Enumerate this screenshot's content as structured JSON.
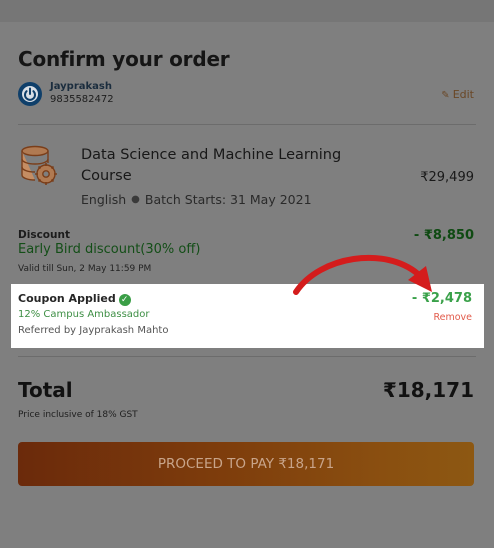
{
  "page": {
    "title": "Confirm your order"
  },
  "user": {
    "name": "Jayprakash",
    "phone": "9835582472",
    "edit_label": "Edit"
  },
  "course": {
    "name": "Data Science and Machine Learning Course",
    "language": "English",
    "batch": "Batch Starts: 31 May 2021",
    "price": "₹29,499"
  },
  "discount": {
    "label": "Discount",
    "name": "Early Bird discount(30% off)",
    "validity": "Valid till Sun, 2 May 11:59 PM",
    "amount": "- ₹8,850"
  },
  "coupon": {
    "label": "Coupon Applied",
    "name": "12% Campus Ambassador",
    "referred_by": "Referred by Jayprakash Mahto",
    "amount": "- ₹2,478",
    "remove_label": "Remove"
  },
  "total": {
    "label": "Total",
    "amount": "₹18,171",
    "gst_note": "Price inclusive of 18% GST"
  },
  "cta": {
    "label": "PROCEED TO PAY ₹18,171"
  },
  "colors": {
    "accent_green": "#3aa14a",
    "remove_red": "#e25a4a",
    "cta_orange": "#e0651c",
    "arrow_red": "#d41c1c"
  },
  "icons": {
    "avatar": "power-logo-icon",
    "edit": "pencil-icon",
    "course": "database-gear-icon",
    "coupon_status": "check-circle-icon",
    "annotation": "curved-arrow-icon"
  }
}
